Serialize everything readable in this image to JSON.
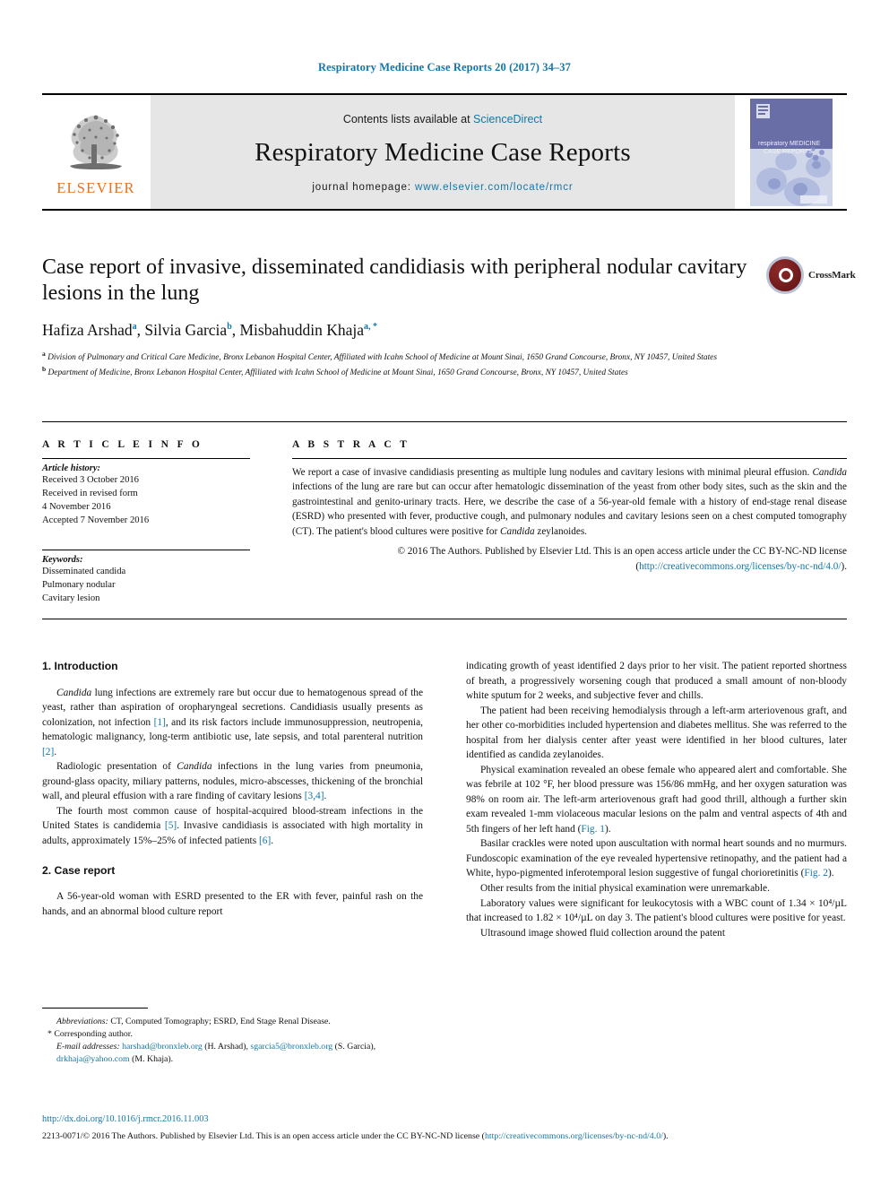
{
  "running_head": "Respiratory Medicine Case Reports 20 (2017) 34–37",
  "masthead": {
    "publisher_name": "ELSEVIER",
    "contents_text": "Contents lists available at ",
    "contents_link": "ScienceDirect",
    "journal_title": "Respiratory Medicine Case Reports",
    "homepage_label": "journal homepage:",
    "homepage_url": "www.elsevier.com/locate/rmcr",
    "cover_line1": "respiratory MEDICINE",
    "cover_line2": "CASE REPORTS"
  },
  "article": {
    "title": "Case report of invasive, disseminated candidiasis with peripheral nodular cavitary lesions in the lung",
    "authors": [
      {
        "name": "Hafiza Arshad",
        "sup": "a"
      },
      {
        "name": "Silvia Garcia",
        "sup": "b"
      },
      {
        "name": "Misbahuddin Khaja",
        "sup": "a, *"
      }
    ],
    "affiliation_a": "Division of Pulmonary and Critical Care Medicine, Bronx Lebanon Hospital Center, Affiliated with Icahn School of Medicine at Mount Sinai, 1650 Grand Concourse, Bronx, NY 10457, United States",
    "affiliation_b": "Department of Medicine, Bronx Lebanon Hospital Center, Affiliated with Icahn School of Medicine at Mount Sinai, 1650 Grand Concourse, Bronx, NY 10457, United States",
    "crossmark_label": "CrossMark"
  },
  "article_info": {
    "heading": "A R T I C L E   I N F O",
    "history_label": "Article history:",
    "history": [
      "Received 3 October 2016",
      "Received in revised form",
      "4 November 2016",
      "Accepted 7 November 2016"
    ],
    "keywords_label": "Keywords:",
    "keywords": [
      "Disseminated candida",
      "Pulmonary nodular",
      "Cavitary lesion"
    ]
  },
  "abstract": {
    "heading": "A B S T R A C T",
    "body_part1": "We report a case of invasive candidiasis presenting as multiple lung nodules and cavitary lesions with minimal pleural effusion. ",
    "italic1": "Candida",
    "body_part2": " infections of the lung are rare but can occur after hematologic dissemination of the yeast from other body sites, such as the skin and the gastrointestinal and genito-urinary tracts. Here, we describe the case of a 56-year-old female with a history of end-stage renal disease (ESRD) who presented with fever, productive cough, and pulmonary nodules and cavitary lesions seen on a chest computed tomography (CT). The patient's blood cultures were positive for ",
    "italic2": "Candida",
    "body_part3": " zeylanoides.",
    "copyright_text": "© 2016 The Authors. Published by Elsevier Ltd. This is an open access article under the CC BY-NC-ND license (",
    "copyright_link": "http://creativecommons.org/licenses/by-nc-nd/4.0/",
    "copyright_tail": ")."
  },
  "body": {
    "section1_heading": "1. Introduction",
    "p1_a": "Candida",
    "p1_b": " lung infections are extremely rare but occur due to hematogenous spread of the yeast, rather than aspiration of oropharyngeal secretions. Candidiasis usually presents as colonization, not infection ",
    "p1_ref1": "[1]",
    "p1_c": ", and its risk factors include immunosuppression, neutropenia, hematologic malignancy, long-term antibiotic use, late sepsis, and total parenteral nutrition ",
    "p1_ref2": "[2]",
    "p1_d": ".",
    "p2_a": "Radiologic presentation of ",
    "p2_italic": "Candida",
    "p2_b": " infections in the lung varies from pneumonia, ground-glass opacity, miliary patterns, nodules, micro-abscesses, thickening of the bronchial wall, and pleural effusion with a rare finding of cavitary lesions ",
    "p2_ref": "[3,4]",
    "p2_c": ".",
    "p3_a": "The fourth most common cause of hospital-acquired blood-stream infections in the United States is candidemia ",
    "p3_ref1": "[5]",
    "p3_b": ". Invasive candidiasis is associated with high mortality in adults, approximately 15%–25% of infected patients ",
    "p3_ref2": "[6]",
    "p3_c": ".",
    "section2_heading": "2. Case report",
    "p4": "A 56-year-old woman with ESRD presented to the ER with fever, painful rash on the hands, and an abnormal blood culture report",
    "r1": "indicating growth of yeast identified 2 days prior to her visit. The patient reported shortness of breath, a progressively worsening cough that produced a small amount of non-bloody white sputum for 2 weeks, and subjective fever and chills.",
    "r2": "The patient had been receiving hemodialysis through a left-arm arteriovenous graft, and her other co-morbidities included hypertension and diabetes mellitus. She was referred to the hospital from her dialysis center after yeast were identified in her blood cultures, later identified as candida zeylanoides.",
    "r3_a": "Physical examination revealed an obese female who appeared alert and comfortable. She was febrile at 102 °F, her blood pressure was 156/86 mmHg, and her oxygen saturation was 98% on room air. The left-arm arteriovenous graft had good thrill, although a further skin exam revealed 1-mm violaceous macular lesions on the palm and ventral aspects of 4th and 5th fingers of her left hand (",
    "r3_link": "Fig. 1",
    "r3_b": ").",
    "r4_a": "Basilar crackles were noted upon auscultation with normal heart sounds and no murmurs. Fundoscopic examination of the eye revealed hypertensive retinopathy, and the patient had a White, hypo-pigmented inferotemporal lesion suggestive of fungal chorioretinitis (",
    "r4_link": "Fig. 2",
    "r4_b": ").",
    "r5": "Other results from the initial physical examination were unremarkable.",
    "r6": "Laboratory values were significant for leukocytosis with a WBC count of 1.34 × 10⁴/µL that increased to 1.82 × 10⁴/µL on day 3. The patient's blood cultures were positive for yeast.",
    "r7": "Ultrasound image showed fluid collection around the patent"
  },
  "footnotes": {
    "abbrev_label": "Abbreviations:",
    "abbrev_text": " CT, Computed Tomography; ESRD, End Stage Renal Disease.",
    "corresponding": "Corresponding author.",
    "email_label": "E-mail addresses:",
    "email1": "harshad@bronxleb.org",
    "email1_name": " (H. Arshad), ",
    "email2": "sgarcia5@bronxleb.org",
    "email2_name": " (S. Garcia), ",
    "email3": "drkhaja@yahoo.com",
    "email3_name": " (M. Khaja)."
  },
  "footer": {
    "doi": "http://dx.doi.org/10.1016/j.rmcr.2016.11.003",
    "legal_prefix": "2213-0071/© 2016 The Authors. Published by Elsevier Ltd. This is an open access article under the CC BY-NC-ND license (",
    "legal_link": "http://creativecommons.org/licenses/by-nc-nd/4.0/",
    "legal_tail": ")."
  },
  "colors": {
    "link": "#1277a8",
    "elsevier_orange": "#E9711C",
    "masthead_gray": "#e6e6e6"
  }
}
